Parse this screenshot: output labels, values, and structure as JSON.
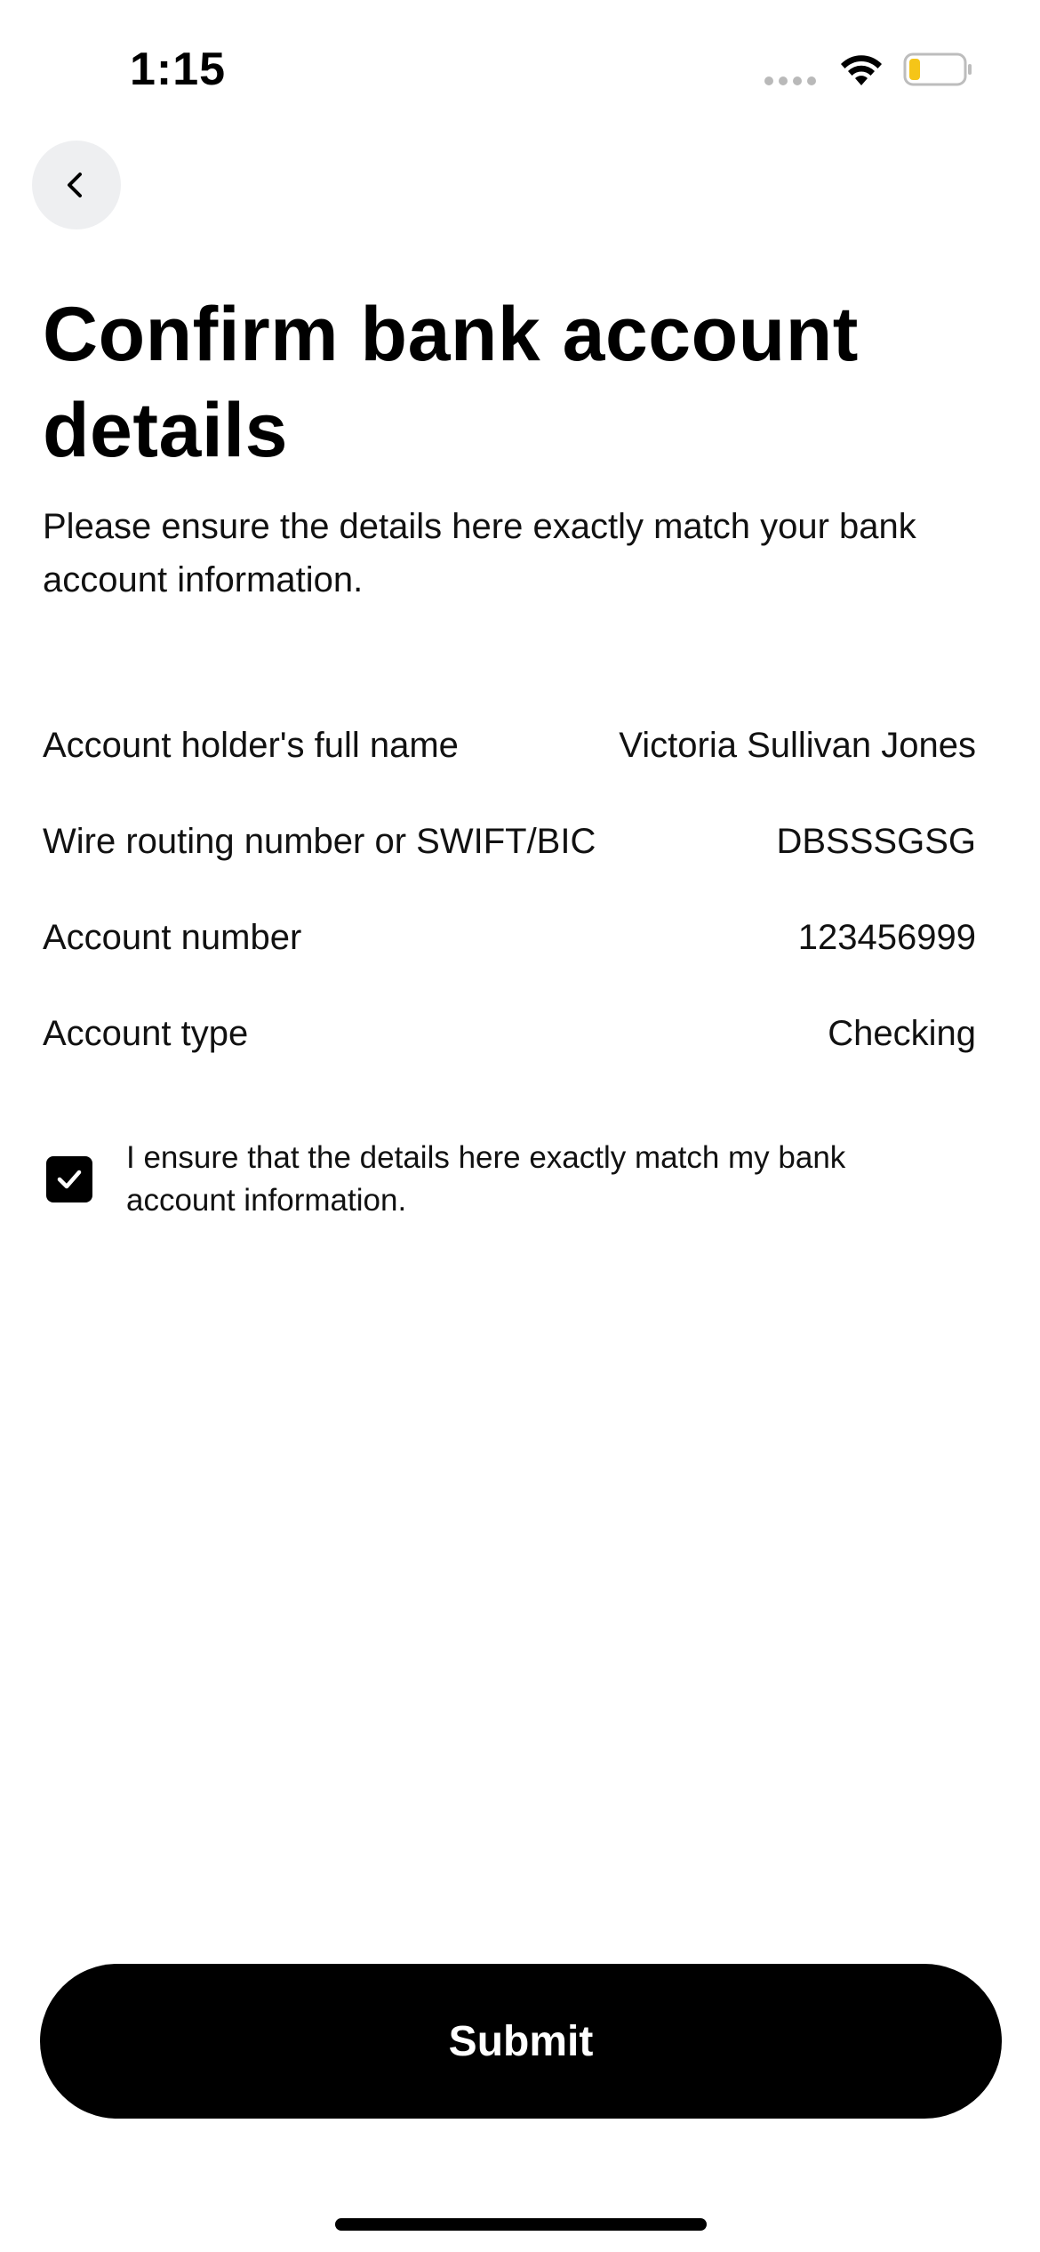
{
  "status_bar": {
    "time": "1:15",
    "icons": [
      "cellular-signal-icon",
      "wifi-icon",
      "battery-icon"
    ],
    "battery_color": "#f5c518"
  },
  "navigation": {
    "back_icon": "chevron-left-icon"
  },
  "header": {
    "title": "Confirm bank account details",
    "subtitle": "Please ensure the details here exactly match your bank account information."
  },
  "details": [
    {
      "label": "Account holder's full name",
      "value": "Victoria Sullivan Jones"
    },
    {
      "label": "Wire routing number or SWIFT/BIC",
      "value": "DBSSSGSG"
    },
    {
      "label": "Account number",
      "value": "123456999"
    },
    {
      "label": "Account type",
      "value": "Checking"
    }
  ],
  "confirmation": {
    "checked": true,
    "text": "I ensure that the details here exactly match my bank account information."
  },
  "actions": {
    "submit_label": "Submit"
  },
  "colors": {
    "primary": "#000000",
    "back_button_bg": "#eeeff1",
    "text": "#111111"
  }
}
